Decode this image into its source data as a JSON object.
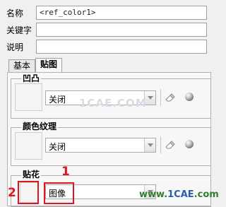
{
  "fields": {
    "name_label": "名称",
    "name_value": "<ref_color1>",
    "keyword_label": "关键字",
    "keyword_value": "",
    "desc_label": "说明",
    "desc_value": ""
  },
  "tabs": [
    {
      "label": "基本",
      "active": false
    },
    {
      "label": "贴图",
      "active": true
    }
  ],
  "groups": {
    "bump": {
      "label": "凹凸",
      "select_value": "关闭"
    },
    "color_texture": {
      "label": "颜色纹理",
      "select_value": "关闭"
    },
    "decal": {
      "label": "贴花",
      "select_value": "图像"
    }
  },
  "annotations": {
    "marker1": "1",
    "marker2": "2"
  },
  "watermark": {
    "text": "1CAE.COM",
    "site_prefix": "www.",
    "site_brand": "1CAE",
    "site_suffix": ".com"
  },
  "colors": {
    "annotation_red": "#e0141e",
    "panel_bg": "#f7f7f7"
  },
  "icons": [
    "eraser-icon",
    "sphere-preview-icon",
    "chevron-down-icon"
  ]
}
